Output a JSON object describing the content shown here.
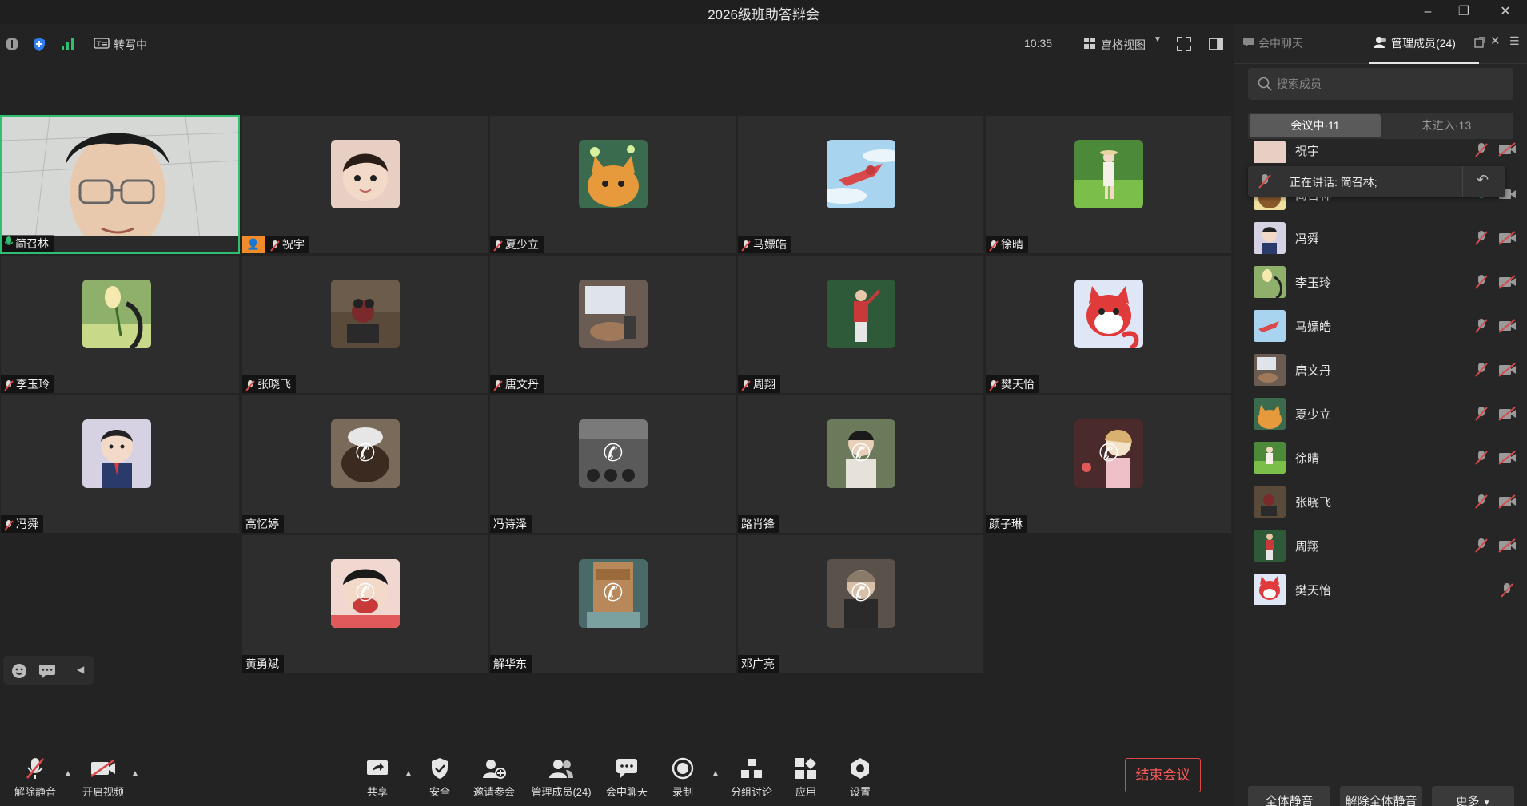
{
  "window": {
    "title": "2026级班助答辩会",
    "minimize": "–",
    "restore": "❐",
    "close": "✕"
  },
  "topbar": {
    "transcribe_label": "转写中",
    "clock": "10:35",
    "view_label": "宫格视图"
  },
  "tiles": [
    {
      "name": "简召林",
      "mic": "on",
      "type": "video"
    },
    {
      "name": "祝宇",
      "mic": "off",
      "type": "avatar",
      "host": true
    },
    {
      "name": "夏少立",
      "mic": "off",
      "type": "avatar"
    },
    {
      "name": "马嫖皓",
      "mic": "off",
      "type": "avatar"
    },
    {
      "name": "徐晴",
      "mic": "off",
      "type": "avatar"
    },
    {
      "name": "李玉玲",
      "mic": "off",
      "type": "avatar"
    },
    {
      "name": "张晓飞",
      "mic": "off",
      "type": "avatar"
    },
    {
      "name": "唐文丹",
      "mic": "off",
      "type": "avatar"
    },
    {
      "name": "周翔",
      "mic": "off",
      "type": "avatar"
    },
    {
      "name": "樊天怡",
      "mic": "off",
      "type": "avatar"
    },
    {
      "name": "冯舜",
      "mic": "off",
      "type": "avatar"
    },
    {
      "name": "高忆婷",
      "mic": "none",
      "type": "calling"
    },
    {
      "name": "冯诗泽",
      "mic": "none",
      "type": "calling"
    },
    {
      "name": "路肖锋",
      "mic": "none",
      "type": "calling"
    },
    {
      "name": "颜子琳",
      "mic": "none",
      "type": "calling"
    },
    {
      "name": "黄勇斌",
      "mic": "none",
      "type": "calling"
    },
    {
      "name": "解华东",
      "mic": "none",
      "type": "calling"
    },
    {
      "name": "邓广亮",
      "mic": "none",
      "type": "calling"
    }
  ],
  "toolbar": {
    "unmute": "解除静音",
    "start_video": "开启视频",
    "share": "共享",
    "security": "安全",
    "invite": "邀请参会",
    "manage": "管理成员(24)",
    "chat": "会中聊天",
    "record": "录制",
    "breakout": "分组讨论",
    "apps": "应用",
    "settings": "设置",
    "end": "结束会议"
  },
  "panel": {
    "tab_chat": "会中聊天",
    "tab_members": "管理成员(24)",
    "search_placeholder": "搜索成员",
    "seg_in": "会议中·11",
    "seg_out": "未进入·13",
    "speaking": "正在讲话: 简召林;",
    "members": [
      {
        "name": "祝宇",
        "mic": "off",
        "cam": "off"
      },
      {
        "name": "简召林",
        "mic": "on",
        "cam": "on"
      },
      {
        "name": "冯舜",
        "mic": "off",
        "cam": "off"
      },
      {
        "name": "李玉玲",
        "mic": "off",
        "cam": "off"
      },
      {
        "name": "马嫖皓",
        "mic": "off",
        "cam": "off"
      },
      {
        "name": "唐文丹",
        "mic": "off",
        "cam": "off"
      },
      {
        "name": "夏少立",
        "mic": "off",
        "cam": "off"
      },
      {
        "name": "徐晴",
        "mic": "off",
        "cam": "off"
      },
      {
        "name": "张晓飞",
        "mic": "off",
        "cam": "off"
      },
      {
        "name": "周翔",
        "mic": "off",
        "cam": "off"
      },
      {
        "name": "樊天怡",
        "mic": "off",
        "cam": "none"
      }
    ],
    "mute_all": "全体静音",
    "unmute_all": "解除全体静音",
    "more": "更多"
  },
  "colors": {
    "accent_green": "#2fbf71",
    "end_red": "#e04848",
    "host_orange": "#f08c2c",
    "mic_off_red": "#d94a4a"
  }
}
